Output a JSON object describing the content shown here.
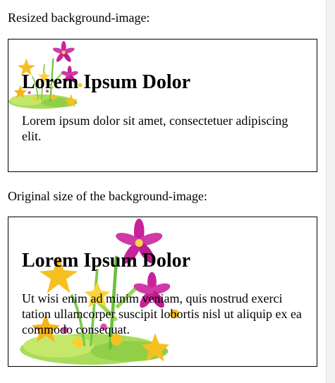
{
  "section_resized": {
    "caption": "Resized background-image:",
    "heading": "Lorem Ipsum Dolor",
    "body": "Lorem ipsum dolor sit amet, consectetuer adipiscing elit."
  },
  "section_original": {
    "caption": "Original size of the background-image:",
    "heading": "Lorem Ipsum Dolor",
    "body": "Ut wisi enim ad minim veniam, quis nostrud exerci tation ullamcorper suscipit lobortis nisl ut aliquip ex ea commodo consequat."
  },
  "colors": {
    "border": "#000000",
    "flower_pink": "#c8239a",
    "flower_yellow": "#f7c021",
    "grass_green": "#8fd14f"
  },
  "icons": {
    "background_image": "flower-bouquet-image"
  }
}
